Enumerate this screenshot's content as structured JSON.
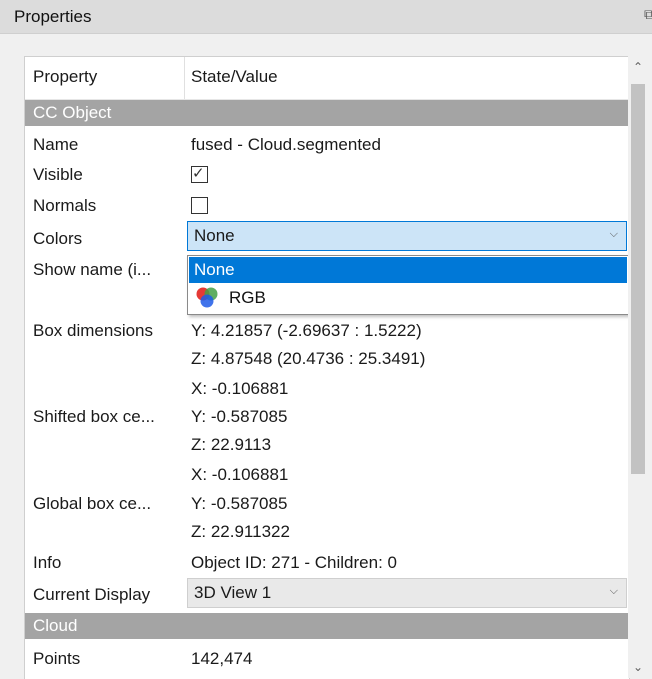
{
  "window": {
    "title": "Properties",
    "float_icon": "restore-icon"
  },
  "table": {
    "header": {
      "property": "Property",
      "value": "State/Value"
    },
    "sections": {
      "cc_object": "CC Object",
      "cloud": "Cloud"
    },
    "rows": {
      "name": {
        "label": "Name",
        "value": "fused - Cloud.segmented"
      },
      "visible": {
        "label": "Visible",
        "checked": true
      },
      "normals": {
        "label": "Normals",
        "checked": false
      },
      "colors": {
        "label": "Colors",
        "value": "None"
      },
      "show_name": {
        "label": "Show name (i..."
      },
      "box_dimensions": {
        "label": "Box dimensions",
        "y": "Y: 4.21857 (-2.69637 : 1.5222)",
        "z": "Z: 4.87548 (20.4736 : 25.3491)"
      },
      "shifted_box": {
        "label": "Shifted box ce...",
        "x": "X: -0.106881",
        "y": "Y: -0.587085",
        "z": "Z: 22.9113"
      },
      "global_box": {
        "label": "Global box ce...",
        "x": "X: -0.106881",
        "y": "Y: -0.587085",
        "z": "Z: 22.911322"
      },
      "info": {
        "label": "Info",
        "value": "Object ID: 271 - Children: 0"
      },
      "current_display": {
        "label": "Current Display",
        "value": "3D View 1"
      },
      "points": {
        "label": "Points",
        "value": "142,474"
      }
    }
  },
  "dropdown": {
    "options": [
      {
        "label": "None",
        "selected": true
      },
      {
        "label": "RGB",
        "icon": "rgb-color-icon"
      }
    ]
  },
  "colors": {
    "accent": "#0078d7",
    "section_bg": "#a4a4a4",
    "combo_bg": "#cce4f7"
  }
}
